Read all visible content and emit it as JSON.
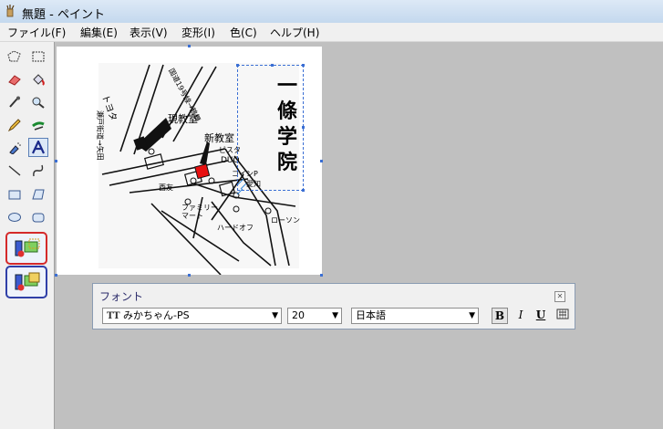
{
  "window": {
    "title": "無題 - ペイント"
  },
  "menu": [
    {
      "label": "ファイル(F)"
    },
    {
      "label": "編集(E)"
    },
    {
      "label": "表示(V)"
    },
    {
      "label": "変形(I)"
    },
    {
      "label": "色(C)"
    },
    {
      "label": "ヘルプ(H)"
    }
  ],
  "tools": [
    "free-form-select-icon",
    "rect-select-icon",
    "eraser-icon",
    "fill-icon",
    "pick-color-icon",
    "magnifier-icon",
    "pencil-icon",
    "brush-icon",
    "airbrush-icon",
    "text-icon",
    "line-icon",
    "curve-icon",
    "rectangle-icon",
    "polygon-icon",
    "ellipse-icon",
    "rounded-rect-icon"
  ],
  "canvas": {
    "map_labels": {
      "current_room": "現教室",
      "new_room": "新教室",
      "vista": "ビスタ",
      "duo": "DUO",
      "coin_p": "コインP",
      "aichi": "愛知",
      "nishitomo": "西友",
      "family_mart": "ファミリー\nマート",
      "hard_off": "ハードオフ",
      "lawson": "ローソン",
      "toyota": "トヨタ",
      "road_tokai": "国道19号線→鶴舞",
      "road_left": "瀬戸街道→矢田"
    },
    "vertical_title": [
      "一",
      "條",
      "学",
      "院"
    ]
  },
  "font_toolbar": {
    "title": "フォント",
    "font_name": "みかちゃん-PS",
    "font_size": "20",
    "script": "日本語",
    "bold": "B",
    "italic": "I",
    "underline": "U",
    "vertical_icon": "vertical-text-icon",
    "font_type_icon": "TT"
  },
  "colors": {
    "highlight_red": "#d42a2a",
    "highlight_blue": "#3040a8",
    "marker_red": "#e81010"
  }
}
